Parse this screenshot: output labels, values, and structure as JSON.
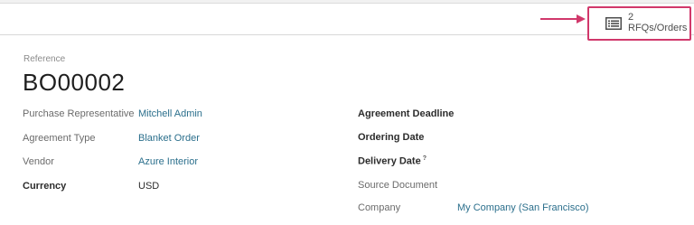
{
  "smart_button": {
    "count": "2",
    "label": "RFQs/Orders",
    "icon": "list-icon",
    "highlight_color": "#d1386b"
  },
  "reference": {
    "label": "Reference",
    "value": "BO00002"
  },
  "left_fields": [
    {
      "label": "Purchase Representative",
      "value": "Mitchell Admin"
    },
    {
      "label": "Agreement Type",
      "value": "Blanket Order"
    },
    {
      "label": "Vendor",
      "value": "Azure Interior"
    },
    {
      "label": "Currency",
      "value": "USD"
    }
  ],
  "right_fields": [
    {
      "label": "Agreement Deadline",
      "value": ""
    },
    {
      "label": "Ordering Date",
      "value": ""
    },
    {
      "label": "Delivery Date",
      "help": "?",
      "value": ""
    },
    {
      "label": "Source Document",
      "value": ""
    },
    {
      "label": "Company",
      "value": "My Company (San Francisco)"
    }
  ],
  "colors": {
    "link": "#2b6f8c",
    "annotation": "#d1386b"
  }
}
